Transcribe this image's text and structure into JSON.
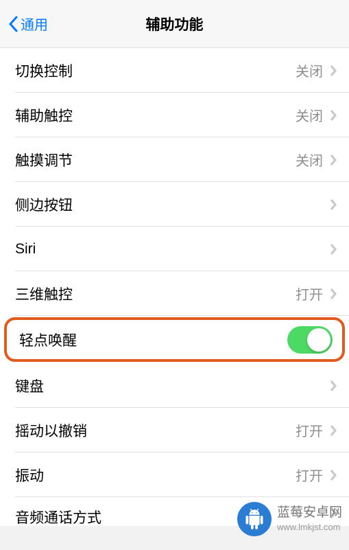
{
  "header": {
    "back_label": "通用",
    "title": "辅助功能"
  },
  "rows": [
    {
      "label": "切换控制",
      "value": "关闭",
      "chevron": true
    },
    {
      "label": "辅助触控",
      "value": "关闭",
      "chevron": true
    },
    {
      "label": "触摸调节",
      "value": "关闭",
      "chevron": true
    },
    {
      "label": "侧边按钮",
      "value": "",
      "chevron": true
    },
    {
      "label": "Siri",
      "value": "",
      "chevron": true
    },
    {
      "label": "三维触控",
      "value": "打开",
      "chevron": true
    },
    {
      "label": "轻点唤醒",
      "highlight": true,
      "toggle_on": true
    },
    {
      "label": "键盘",
      "value": "",
      "chevron": true
    },
    {
      "label": "摇动以撤销",
      "value": "打开",
      "chevron": true
    },
    {
      "label": "振动",
      "value": "打开",
      "chevron": true
    },
    {
      "label": "音频通话方式",
      "value": "",
      "chevron": true,
      "cutoff": true
    }
  ],
  "watermark": {
    "main": "蓝莓安卓网",
    "sub": "www.lmkjst.com"
  }
}
